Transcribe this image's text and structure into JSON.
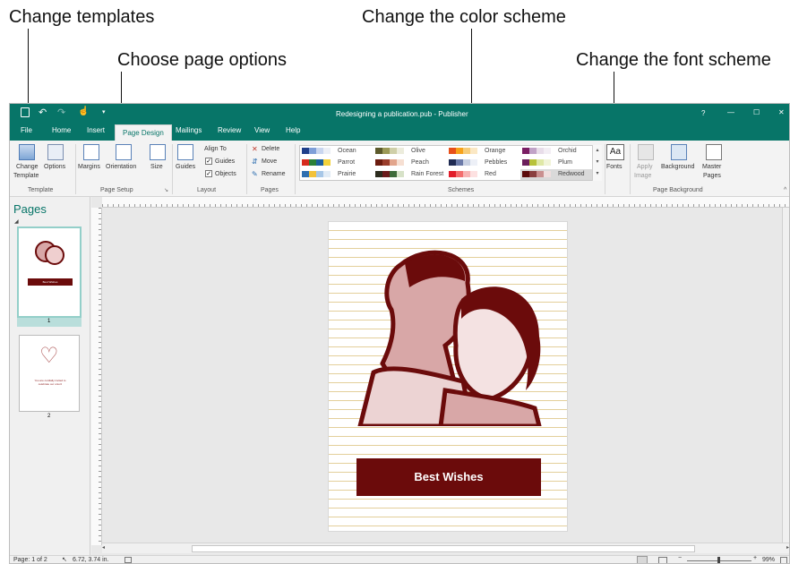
{
  "callouts": {
    "templates": "Change templates",
    "page_options": "Choose page options",
    "color_scheme": "Change the color scheme",
    "font_scheme": "Change the font scheme"
  },
  "window": {
    "title": "Redesigning a publication.pub  -  Publisher",
    "help": "?",
    "minimize": "—",
    "restore": "☐",
    "close": "✕"
  },
  "tabs": [
    "File",
    "Home",
    "Insert",
    "Page Design",
    "Mailings",
    "Review",
    "View",
    "Help"
  ],
  "ribbon": {
    "template": {
      "change": "Change",
      "template": "Template",
      "options": "Options",
      "group": "Template"
    },
    "page_setup": {
      "margins": "Margins",
      "orientation": "Orientation",
      "size": "Size",
      "group": "Page Setup"
    },
    "layout": {
      "guides": "Guides",
      "align_to": "Align To",
      "guides_check": "Guides",
      "objects_check": "Objects",
      "group": "Layout"
    },
    "pages": {
      "delete": "Delete",
      "move": "Move",
      "rename": "Rename",
      "group": "Pages"
    },
    "schemes": {
      "group": "Schemes",
      "items": [
        {
          "name": "Ocean",
          "colors": [
            "#1f3f8a",
            "#7f9fd8",
            "#c9d6ef",
            "#eceff6"
          ]
        },
        {
          "name": "Olive",
          "colors": [
            "#5c5a2b",
            "#9c9a57",
            "#cfcfa8",
            "#ececdc"
          ]
        },
        {
          "name": "Orange",
          "colors": [
            "#e8501a",
            "#f7a21b",
            "#f6cc7a",
            "#fbe8c4"
          ]
        },
        {
          "name": "Orchid",
          "colors": [
            "#7a1f64",
            "#c1a3c7",
            "#e8dde9",
            "#f3eef4"
          ]
        },
        {
          "name": "Parrot",
          "colors": [
            "#d62b1e",
            "#2a7f38",
            "#1c5f9e",
            "#f3d23b"
          ]
        },
        {
          "name": "Peach",
          "colors": [
            "#6b1c0f",
            "#9a3d2b",
            "#e2a58c",
            "#f6dfd2"
          ]
        },
        {
          "name": "Pebbles",
          "colors": [
            "#1f2a52",
            "#6b7aa8",
            "#c8d0e2",
            "#edf0f7"
          ]
        },
        {
          "name": "Plum",
          "colors": [
            "#6b1f5c",
            "#b8c23a",
            "#dfe8a6",
            "#f1f4d8"
          ]
        },
        {
          "name": "Prairie",
          "colors": [
            "#2e6fb0",
            "#f2c23a",
            "#a7c7e7",
            "#e2ecf6"
          ]
        },
        {
          "name": "Rain Forest",
          "colors": [
            "#2c2c1e",
            "#6a1b1b",
            "#3f6b3a",
            "#d7e2c8"
          ]
        },
        {
          "name": "Red",
          "colors": [
            "#e11d2a",
            "#f36d6d",
            "#f7b3b3",
            "#fde1e1"
          ]
        },
        {
          "name": "Redwood",
          "colors": [
            "#5c0b0b",
            "#8a3f3f",
            "#c98f8f",
            "#efdede"
          ]
        }
      ],
      "selected": "Redwood"
    },
    "fonts": {
      "label": "Fonts",
      "icon_text": "Aa"
    },
    "background": {
      "apply": "Apply",
      "image": "Image",
      "background": "Background",
      "master": "Master",
      "pages": "Pages",
      "group": "Page Background"
    }
  },
  "pages_pane": {
    "title": "Pages",
    "page1_num": "1",
    "page2_num": "2",
    "page1_banner": "Best Wishes",
    "page2_text": "You are cordially invited to celebrate our union!"
  },
  "document": {
    "banner": "Best Wishes"
  },
  "status": {
    "page": "Page: 1 of 2",
    "position": "6.72, 3.74 in.",
    "zoom": "99%"
  },
  "colors": {
    "accent": "#077568",
    "banner": "#6b0b0b",
    "illustration_dark": "#6b0b0b",
    "illustration_light": "#d8a7a7"
  }
}
